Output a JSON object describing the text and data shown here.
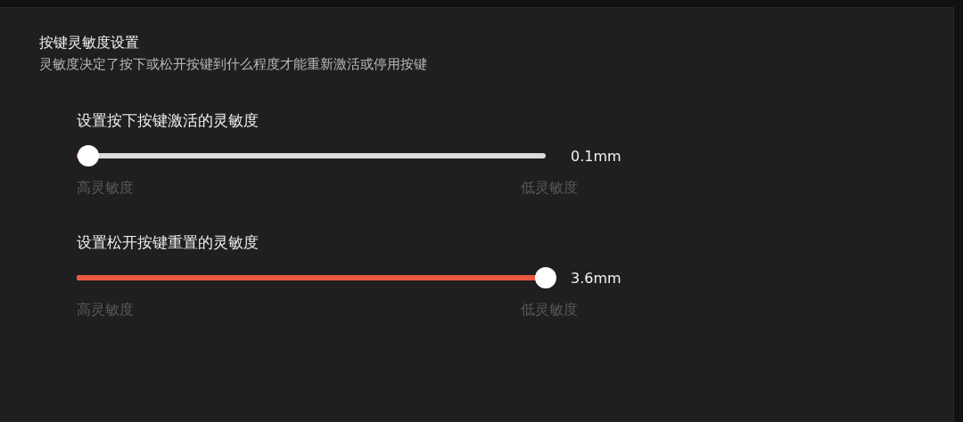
{
  "title": "按键灵敏度设置",
  "subtitle": "灵敏度决定了按下或松开按键到什么程度才能重新激活或停用按键",
  "sliders": [
    {
      "label": "设置按下按键激活的灵敏度",
      "level": 0.025,
      "reading": "0.1mm",
      "min_label": "高灵敏度",
      "max_label": "低灵敏度"
    },
    {
      "label": "设置松开按键重置的灵敏度",
      "level": 1,
      "reading": "3.6mm",
      "min_label": "高灵敏度",
      "max_label": "低灵敏度"
    }
  ]
}
